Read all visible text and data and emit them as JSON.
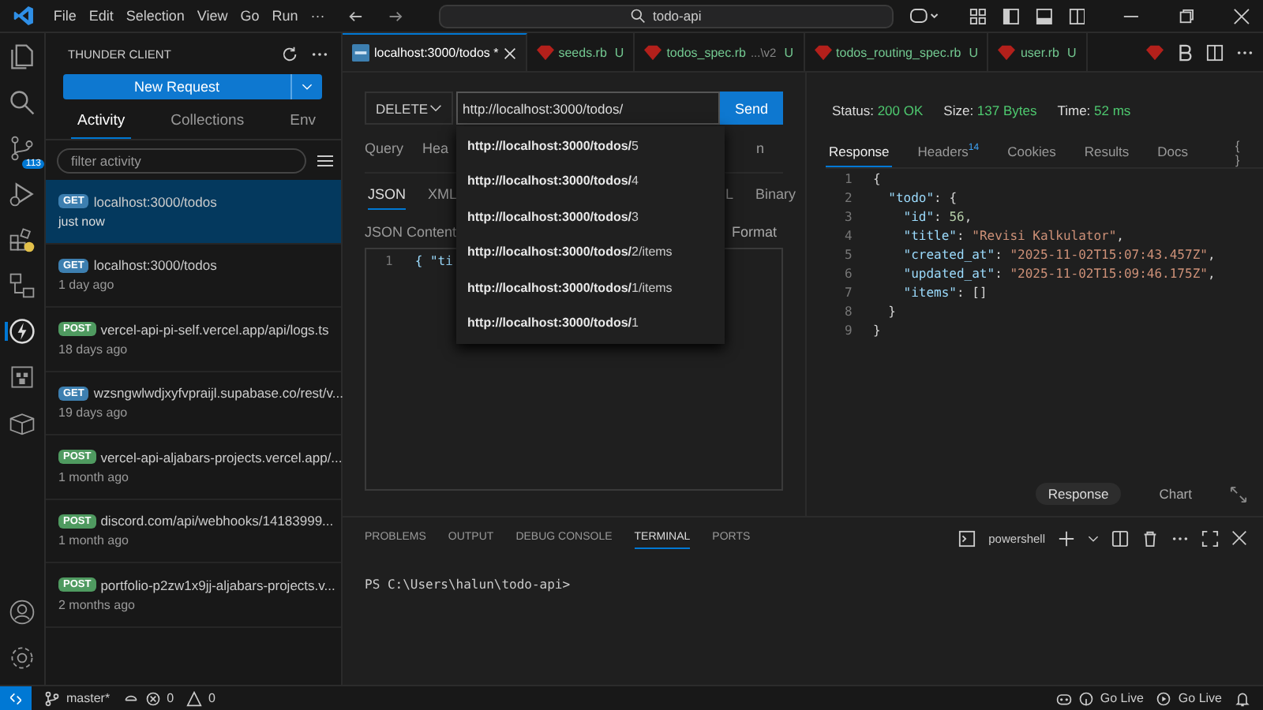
{
  "menu": [
    "File",
    "Edit",
    "Selection",
    "View",
    "Go",
    "Run",
    "···"
  ],
  "search": {
    "value": "todo-api"
  },
  "activity_bar": {
    "source_control_badge": "113"
  },
  "sidebar": {
    "title": "THUNDER CLIENT",
    "new_request": "New Request",
    "tabs": [
      {
        "label": "Activity",
        "selected": true
      },
      {
        "label": "Collections",
        "selected": false
      },
      {
        "label": "Env",
        "selected": false
      }
    ],
    "filter": {
      "placeholder": "filter activity"
    },
    "items": [
      {
        "method": "GET",
        "color": "#3d7fb0",
        "url": "localhost:3000/todos",
        "time": "just now",
        "selected": true
      },
      {
        "method": "GET",
        "color": "#3d7fb0",
        "url": "localhost:3000/todos",
        "time": "1 day ago",
        "selected": false
      },
      {
        "method": "POST",
        "color": "#4f9a60",
        "url": "vercel-api-pi-self.vercel.app/api/logs.ts",
        "time": "18 days ago",
        "selected": false
      },
      {
        "method": "GET",
        "color": "#3d7fb0",
        "url": "wzsngwlwdjxyfvpraijl.supabase.co/rest/v...",
        "time": "19 days ago",
        "selected": false
      },
      {
        "method": "POST",
        "color": "#4f9a60",
        "url": "vercel-api-aljabars-projects.vercel.app/...",
        "time": "1 month ago",
        "selected": false
      },
      {
        "method": "POST",
        "color": "#4f9a60",
        "url": "discord.com/api/webhooks/14183999...",
        "time": "1 month ago",
        "selected": false
      },
      {
        "method": "POST",
        "color": "#4f9a60",
        "url": "portfolio-p2zw1x9jj-aljabars-projects.v...",
        "time": "2 months ago",
        "selected": false
      }
    ]
  },
  "tabs": [
    {
      "kind": "thunder",
      "label": "localhost:3000/todos *",
      "selected": true
    },
    {
      "kind": "ruby",
      "label": "seeds.rb",
      "status": "U",
      "selected": false
    },
    {
      "kind": "ruby",
      "label": "todos_spec.rb",
      "hint": "...\\v2",
      "status": "U",
      "selected": false
    },
    {
      "kind": "ruby",
      "label": "todos_routing_spec.rb",
      "status": "U",
      "selected": false
    },
    {
      "kind": "ruby",
      "label": "user.rb",
      "status": "U",
      "selected": false
    }
  ],
  "request": {
    "method": "DELETE",
    "url": "http://localhost:3000/todos/",
    "send": "Send",
    "tabs_left": [
      "Query",
      "Hea"
    ],
    "tabs_right": [
      "n"
    ],
    "body_tabs_left": [
      {
        "label": "JSON",
        "selected": true
      },
      {
        "label": "XML",
        "selected": false
      }
    ],
    "body_tabs_right": [
      {
        "label": "L",
        "selected": false
      },
      {
        "label": "Binary",
        "selected": false
      }
    ],
    "content_label": "JSON Content",
    "format": "Format",
    "line_number": "1",
    "body_text": "{ \"ti",
    "suggestions": [
      {
        "bold": "http://localhost:3000/todos/",
        "rest": "5"
      },
      {
        "bold": "http://localhost:3000/todos/",
        "rest": "4"
      },
      {
        "bold": "http://localhost:3000/todos/",
        "rest": "3"
      },
      {
        "bold": "http://localhost:3000/todos/",
        "rest": "2/items"
      },
      {
        "bold": "http://localhost:3000/todos/",
        "rest": "1/items"
      },
      {
        "bold": "http://localhost:3000/todos/",
        "rest": "1"
      }
    ]
  },
  "response": {
    "stats": [
      {
        "label": "Status:",
        "value": "200 OK"
      },
      {
        "label": "Size:",
        "value": "137 Bytes"
      },
      {
        "label": "Time:",
        "value": "52 ms"
      }
    ],
    "tabs": [
      {
        "label": "Response",
        "selected": true
      },
      {
        "label": "Headers",
        "count": "14",
        "selected": false
      },
      {
        "label": "Cookies",
        "selected": false
      },
      {
        "label": "Results",
        "selected": false
      },
      {
        "label": "Docs",
        "selected": false
      }
    ],
    "braces_button": "{ }",
    "lines": [
      {
        "number": "1",
        "code": "{"
      },
      {
        "number": "2",
        "code": "  \"todo\": {"
      },
      {
        "number": "3",
        "code": "    \"id\": 56,"
      },
      {
        "number": "4",
        "code": "    \"title\": \"Revisi Kalkulator\","
      },
      {
        "number": "5",
        "code": "    \"created_at\": \"2025-11-02T15:07:43.457Z\","
      },
      {
        "number": "6",
        "code": "    \"updated_at\": \"2025-11-02T15:09:46.175Z\","
      },
      {
        "number": "7",
        "code": "    \"items\": []"
      },
      {
        "number": "8",
        "code": "  }"
      },
      {
        "number": "9",
        "code": "}"
      }
    ],
    "views": [
      {
        "label": "Response",
        "selected": true
      },
      {
        "label": "Chart",
        "selected": false
      }
    ]
  },
  "panel": {
    "tabs": [
      {
        "label": "PROBLEMS",
        "selected": false
      },
      {
        "label": "OUTPUT",
        "selected": false
      },
      {
        "label": "DEBUG CONSOLE",
        "selected": false
      },
      {
        "label": "TERMINAL",
        "selected": true
      },
      {
        "label": "PORTS",
        "selected": false
      }
    ],
    "shell": "powershell",
    "prompt": "PS C:\\Users\\halun\\todo-api>"
  },
  "status_bar": {
    "branch": "master*",
    "errors": "0",
    "warnings": "0",
    "go_live": [
      "Go Live",
      "Go Live"
    ]
  }
}
